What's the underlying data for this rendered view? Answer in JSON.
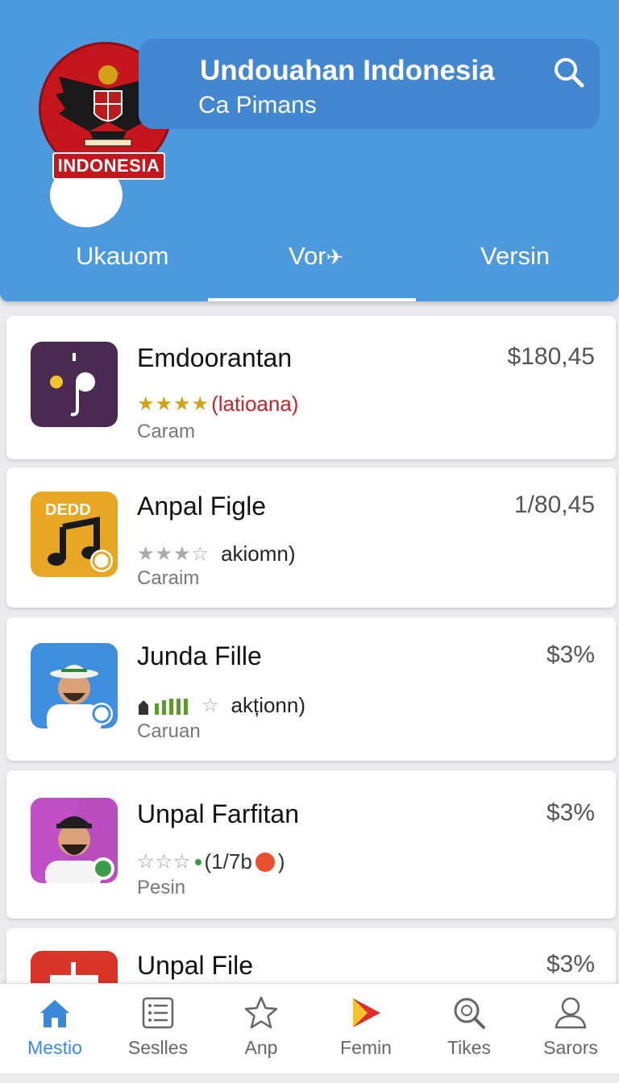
{
  "header": {
    "logo_text": "INDONESIA",
    "title": "Undouahan Indonesia",
    "subtitle": "Ca Pimans",
    "search_icon": "search-icon"
  },
  "tabs": [
    {
      "label": "Ukauom"
    },
    {
      "label": "Vor"
    },
    {
      "label": "Versin"
    }
  ],
  "apps": [
    {
      "name": "Emdoorantan",
      "price": "$180,45",
      "rating_text": "(latioana)",
      "stars": "★★★★",
      "sub": "Caram",
      "icon": "music-note-dark-icon"
    },
    {
      "name": "Anpal Figle",
      "price": "1/80,45",
      "rating_text": "akiomn)",
      "stars": "★★★☆",
      "sub": "Caraim",
      "icon": "deed-music-icon",
      "icon_label": "DEDD"
    },
    {
      "name": "Junda Fille",
      "price": "$3%",
      "rating_text": "akționn)",
      "stars": "☆",
      "sub": "Caruan",
      "icon": "man-hat-icon"
    },
    {
      "name": "Unpal Farfitan",
      "price": "$3%",
      "rating_text": "(1/7b",
      "rating_end": ")",
      "stars": "☆☆☆",
      "sub": "Pesin",
      "icon": "man-cap-icon"
    },
    {
      "name": "Unpal File",
      "price": "$3%",
      "icon": "red-app-icon"
    }
  ],
  "nav": [
    {
      "label": "Mestio",
      "icon": "home-icon"
    },
    {
      "label": "Seslles",
      "icon": "list-icon"
    },
    {
      "label": "Anp",
      "icon": "star-icon"
    },
    {
      "label": "Femin",
      "icon": "play-icon"
    },
    {
      "label": "Tikes",
      "icon": "search-icon"
    },
    {
      "label": "Sarors",
      "icon": "person-icon"
    }
  ],
  "colors": {
    "header": "#4d99de",
    "accent": "#3b8ad9"
  }
}
